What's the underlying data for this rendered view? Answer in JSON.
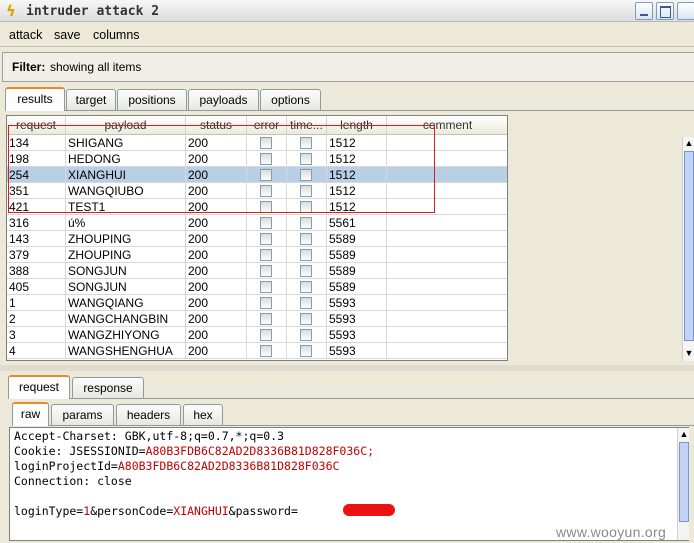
{
  "window": {
    "title": "intruder attack 2"
  },
  "menu": {
    "items": [
      "attack",
      "save",
      "columns"
    ]
  },
  "filter": {
    "label": "Filter:",
    "value": "showing all items"
  },
  "main_tabs": [
    "results",
    "target",
    "positions",
    "payloads",
    "options"
  ],
  "table": {
    "columns": [
      "request",
      "payload",
      "status",
      "error",
      "time...",
      "length",
      "comment"
    ],
    "rows": [
      {
        "request": "134",
        "payload": "SHIGANG",
        "status": "200",
        "length": "1512",
        "selected": false
      },
      {
        "request": "198",
        "payload": "HEDONG",
        "status": "200",
        "length": "1512",
        "selected": false
      },
      {
        "request": "254",
        "payload": "XIANGHUI",
        "status": "200",
        "length": "1512",
        "selected": true
      },
      {
        "request": "351",
        "payload": "WANGQIUBO",
        "status": "200",
        "length": "1512",
        "selected": false
      },
      {
        "request": "421",
        "payload": "TEST1",
        "status": "200",
        "length": "1512",
        "selected": false
      },
      {
        "request": "316",
        "payload": "ú%",
        "status": "200",
        "length": "5561",
        "selected": false
      },
      {
        "request": "143",
        "payload": "ZHOUPING",
        "status": "200",
        "length": "5589",
        "selected": false
      },
      {
        "request": "379",
        "payload": "ZHOUPING",
        "status": "200",
        "length": "5589",
        "selected": false
      },
      {
        "request": "388",
        "payload": "SONGJUN",
        "status": "200",
        "length": "5589",
        "selected": false
      },
      {
        "request": "405",
        "payload": "SONGJUN",
        "status": "200",
        "length": "5589",
        "selected": false
      },
      {
        "request": "1",
        "payload": "WANGQIANG",
        "status": "200",
        "length": "5593",
        "selected": false
      },
      {
        "request": "2",
        "payload": "WANGCHANGBIN",
        "status": "200",
        "length": "5593",
        "selected": false
      },
      {
        "request": "3",
        "payload": "WANGZHIYONG",
        "status": "200",
        "length": "5593",
        "selected": false
      },
      {
        "request": "4",
        "payload": "WANGSHENGHUA",
        "status": "200",
        "length": "5593",
        "selected": false
      }
    ]
  },
  "detail_tabs": [
    "request",
    "response"
  ],
  "view_tabs": [
    "raw",
    "params",
    "headers",
    "hex"
  ],
  "request_text": {
    "accept_charset": "Accept-Charset: GBK,utf-8;q=0.7,*;q=0.3",
    "cookie_key": "Cookie: JSESSIONID=",
    "cookie_val": "A80B3FDB6C82AD2D8336B81D828F036C;",
    "login_key": "loginProjectId=",
    "login_val": "A80B3FDB6C82AD2D8336B81D828F036C",
    "connection": "Connection: close",
    "body_a": "loginType=",
    "body_b": "1",
    "body_c": "&personCode=",
    "body_d": "XIANGHUI",
    "body_e": "&password="
  },
  "watermark": "www.wooyun.org",
  "colors": {
    "selected_row": "#b8cfe5",
    "highlight_box": "#d02020",
    "value_text": "#c00000"
  }
}
